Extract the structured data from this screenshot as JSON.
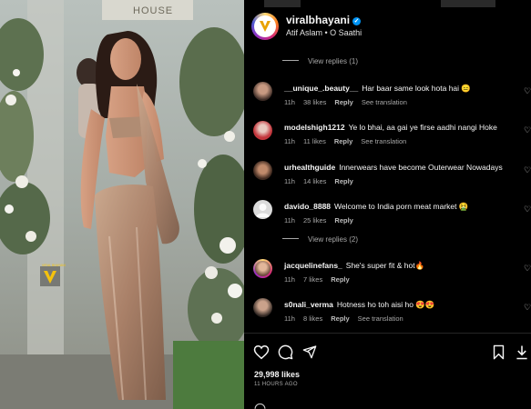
{
  "photo": {
    "sign_text": "HOUSE",
    "watermark_text": "VIRAL BHAYANI"
  },
  "post": {
    "username": "viralbhayani",
    "verified_badge": "✓",
    "audio": "Atif Aslam • O Saathi"
  },
  "comments_section": {
    "view_replies_top": "View replies (1)",
    "view_replies_mid": "View replies (2)",
    "comments": [
      {
        "user": "__unique_.beauty__",
        "text": "Har baar same look hota hai 😑",
        "time": "11h",
        "likes": "38 likes",
        "reply": "Reply",
        "translate": "See translation"
      },
      {
        "user": "modelshigh1212",
        "text": "Ye lo bhai, aa gai ye firse aadhi nangi Hoke",
        "time": "11h",
        "likes": "11 likes",
        "reply": "Reply",
        "translate": "See translation"
      },
      {
        "user": "urhealthguide",
        "text": "Innerwears have become Outerwear Nowadays",
        "time": "11h",
        "likes": "14 likes",
        "reply": "Reply",
        "translate": ""
      },
      {
        "user": "davido_8888",
        "text": "Welcome to India porn meat market 🤮",
        "time": "11h",
        "likes": "25 likes",
        "reply": "Reply",
        "translate": ""
      },
      {
        "user": "jacquelinefans_",
        "text": "She's super fit & hot🔥",
        "time": "11h",
        "likes": "7 likes",
        "reply": "Reply",
        "translate": ""
      },
      {
        "user": "s0nali_verma",
        "text": "Hotness ho toh aisi ho 😍😍",
        "time": "11h",
        "likes": "8 likes",
        "reply": "Reply",
        "translate": "See translation"
      }
    ]
  },
  "footer": {
    "likes": "29,998 likes",
    "time": "11 HOURS AGO"
  },
  "colors": {
    "background": "#000000",
    "accent": "#0095f6",
    "muted_text": "#a8a8a8"
  },
  "icons": [
    "heart-icon",
    "comment-icon",
    "share-icon",
    "save-icon",
    "download-icon",
    "verified-icon"
  ]
}
